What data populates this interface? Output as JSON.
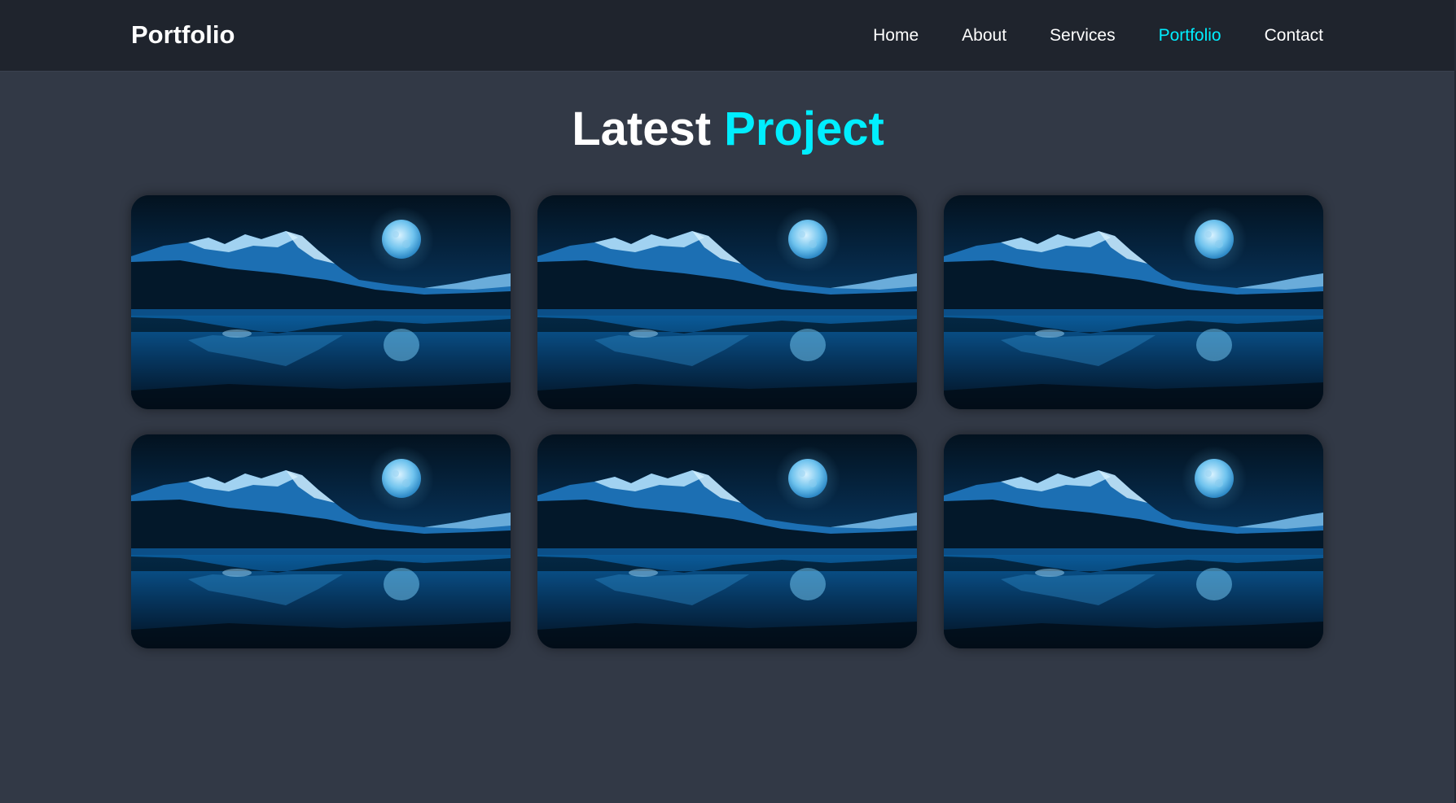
{
  "header": {
    "logo": "Portfolio",
    "nav": [
      {
        "label": "Home",
        "active": false
      },
      {
        "label": "About",
        "active": false
      },
      {
        "label": "Services",
        "active": false
      },
      {
        "label": "Portfolio",
        "active": true
      },
      {
        "label": "Contact",
        "active": false
      }
    ]
  },
  "section": {
    "title_main": "Latest",
    "title_accent": "Project"
  },
  "projects": [
    {
      "image": "moonlit-mountain-lake"
    },
    {
      "image": "moonlit-mountain-lake"
    },
    {
      "image": "moonlit-mountain-lake"
    },
    {
      "image": "moonlit-mountain-lake"
    },
    {
      "image": "moonlit-mountain-lake"
    },
    {
      "image": "moonlit-mountain-lake"
    }
  ],
  "colors": {
    "background": "#323946",
    "header": "#1f242d",
    "accent": "#00eeff",
    "text": "#ffffff"
  }
}
